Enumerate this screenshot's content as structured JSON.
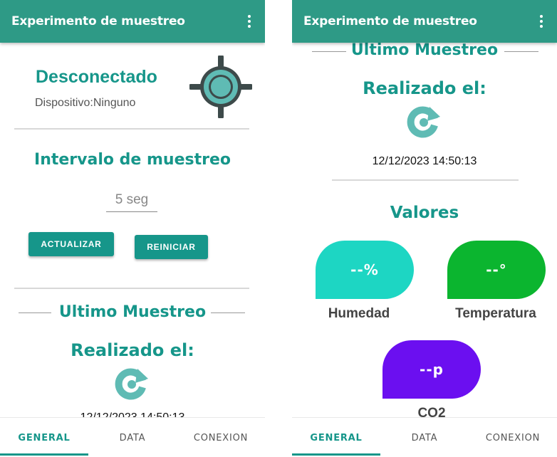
{
  "left": {
    "appbar": {
      "title": "Experimento de muestreo",
      "menu_icon": "more-vert-icon"
    },
    "status": {
      "state": "Desconectado",
      "device_label": "Dispositivo:",
      "device_value": "Ninguno",
      "icon": "target-icon"
    },
    "interval": {
      "title": "Intervalo de muestreo",
      "value": "5 seg"
    },
    "buttons": {
      "update": "ACTUALIZAR",
      "reset": "REINICIAR"
    },
    "last_sample": {
      "title": "Ultimo Muestreo",
      "done_label": "Realizado el:",
      "icon": "refresh-icon",
      "timestamp": "12/12/2023 14:50:13"
    }
  },
  "right": {
    "appbar": {
      "title": "Experimento de muestreo",
      "menu_icon": "more-vert-icon"
    },
    "last_sample": {
      "title": "Ultimo Muestreo",
      "done_label": "Realizado el:",
      "icon": "refresh-icon",
      "timestamp": "12/12/2023 14:50:13"
    },
    "values": {
      "title": "Valores",
      "humidity": {
        "value": "--%",
        "label": "Humedad",
        "color": "#1dd6c3"
      },
      "temperature": {
        "value": "--°",
        "label": "Temperatura",
        "color": "#0bb52f"
      },
      "co2": {
        "value": "--p",
        "label": "CO2",
        "color": "#6b0ff0"
      }
    }
  },
  "bottom_nav": {
    "tabs": [
      "GENERAL",
      "DATA",
      "CONEXION"
    ],
    "active": "GENERAL"
  },
  "colors": {
    "primary": "#2e9a86",
    "accent": "#16968a"
  }
}
